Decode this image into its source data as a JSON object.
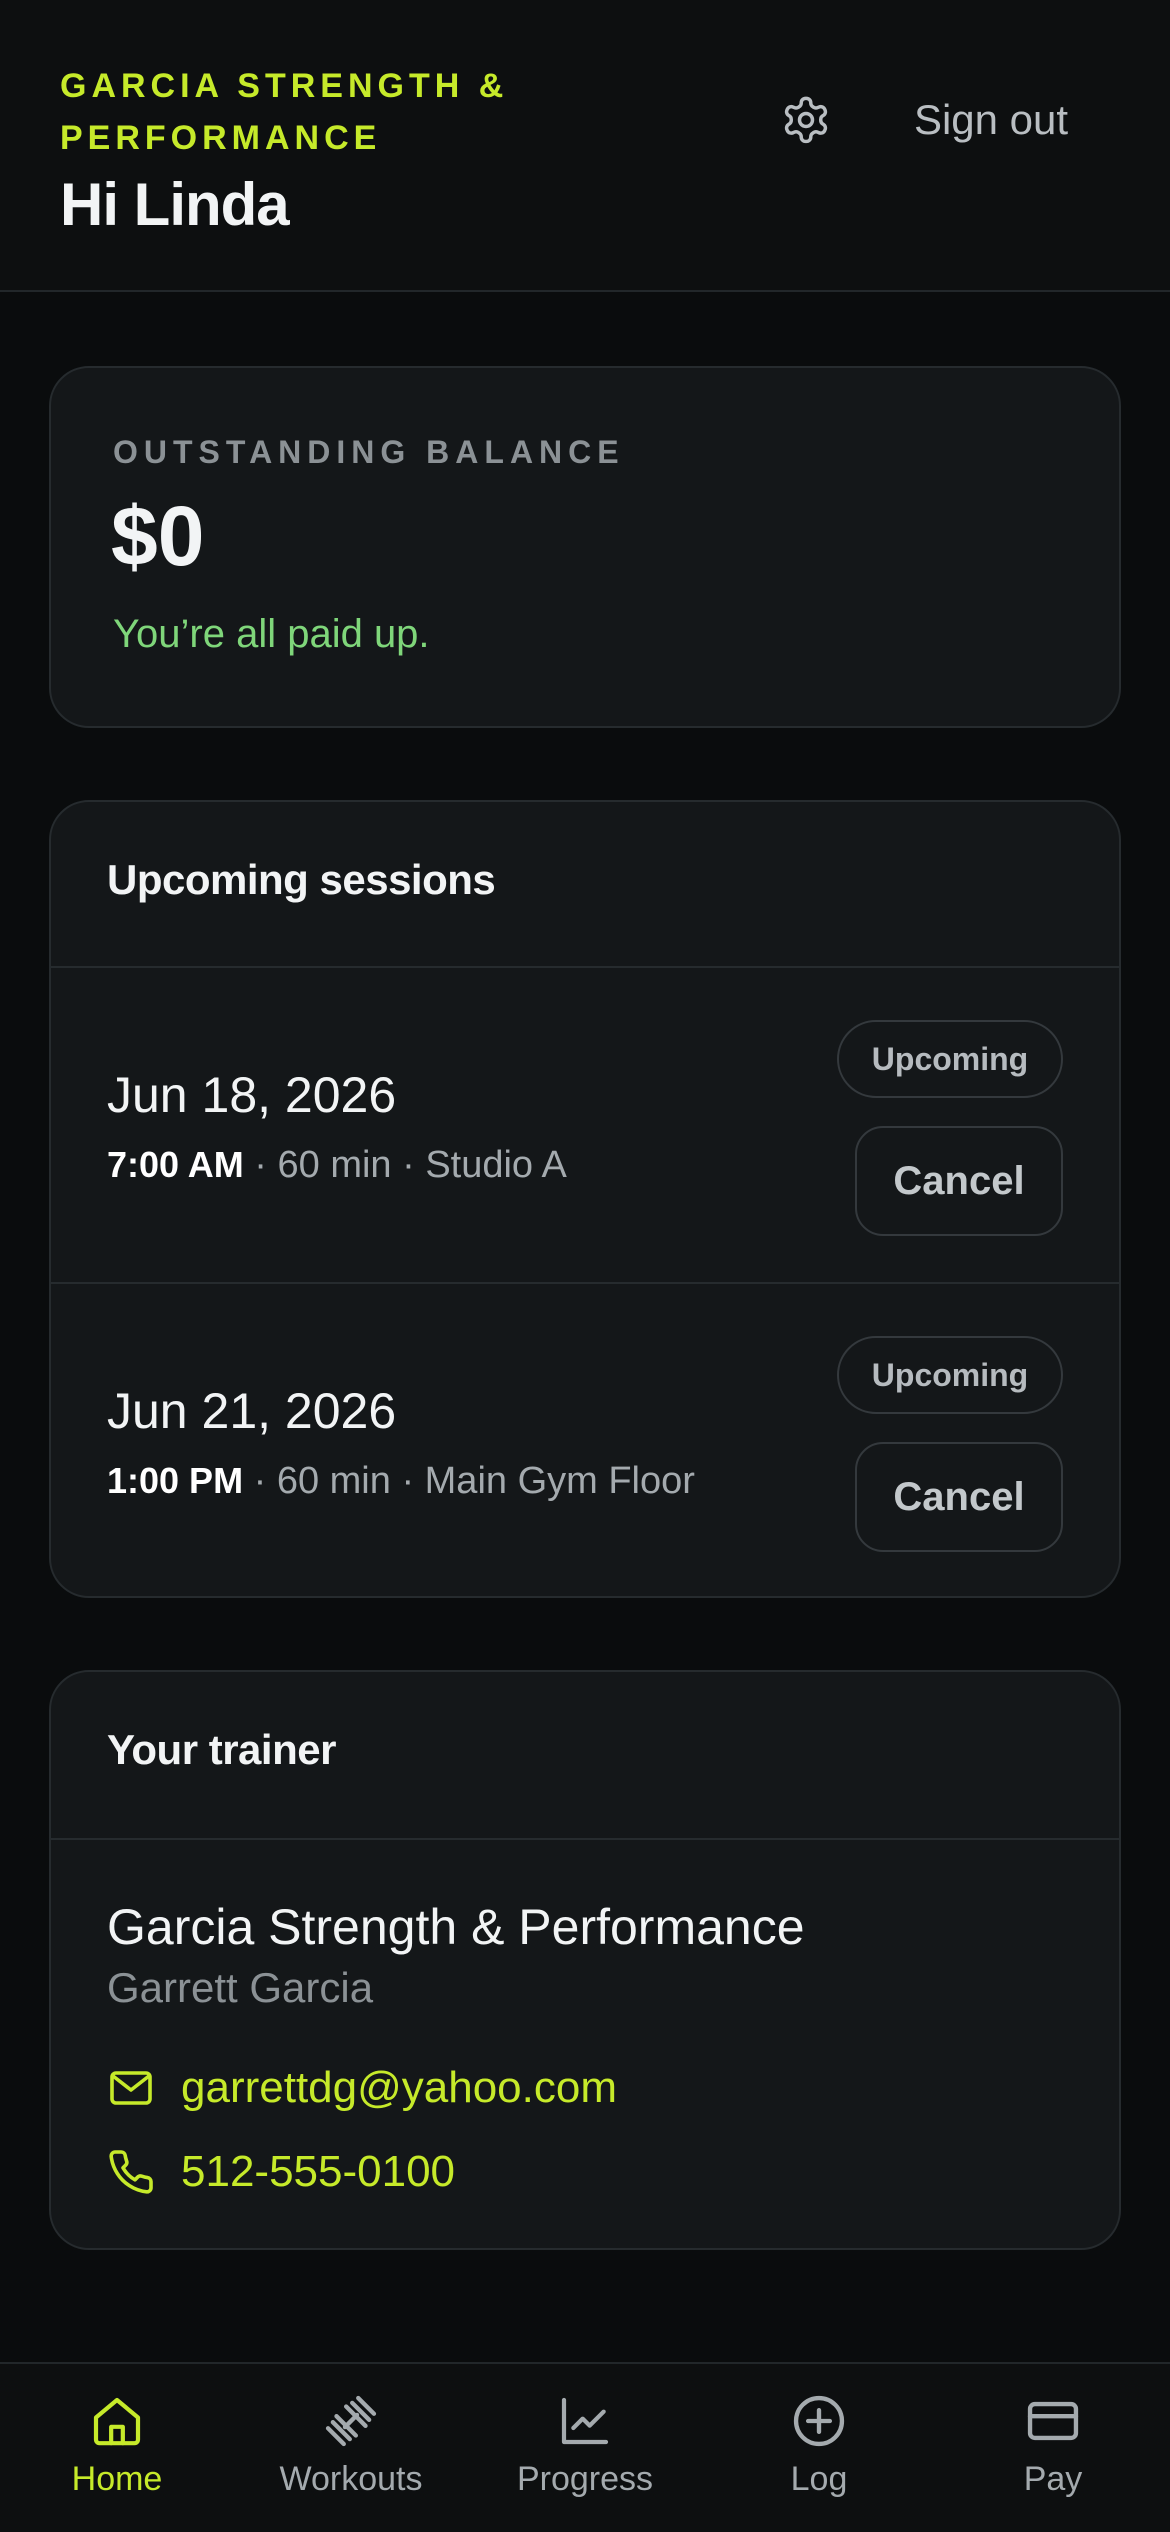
{
  "header": {
    "brand": "GARCIA STRENGTH & PERFORMANCE",
    "greeting": "Hi Linda",
    "settings_icon": "gear-icon",
    "signout_label": "Sign out"
  },
  "balance": {
    "label": "OUTSTANDING BALANCE",
    "amount": "$0",
    "status": "You’re all paid up.",
    "status_color": "#7fd67a"
  },
  "sessions": {
    "title": "Upcoming sessions",
    "items": [
      {
        "date": "Jun 18, 2026",
        "time": "7:00 AM",
        "details": " · 60 min · Studio A",
        "badge": "Upcoming",
        "cancel_label": "Cancel"
      },
      {
        "date": "Jun 21, 2026",
        "time": "1:00 PM",
        "details": " · 60 min · Main Gym Floor",
        "badge": "Upcoming",
        "cancel_label": "Cancel"
      }
    ]
  },
  "trainer": {
    "title": "Your trainer",
    "business": "Garcia Strength & Performance",
    "name": "Garrett Garcia",
    "email": "garrettdg@yahoo.com",
    "phone": "512-555-0100"
  },
  "tabs": [
    {
      "label": "Home",
      "icon": "home-icon",
      "active": true
    },
    {
      "label": "Workouts",
      "icon": "dumbbell-icon",
      "active": false
    },
    {
      "label": "Progress",
      "icon": "chart-icon",
      "active": false
    },
    {
      "label": "Log",
      "icon": "plus-circle-icon",
      "active": false
    },
    {
      "label": "Pay",
      "icon": "card-icon",
      "active": false
    }
  ],
  "colors": {
    "accent": "#c6ea2a",
    "background": "#0a0c0d",
    "card": "#141719"
  }
}
